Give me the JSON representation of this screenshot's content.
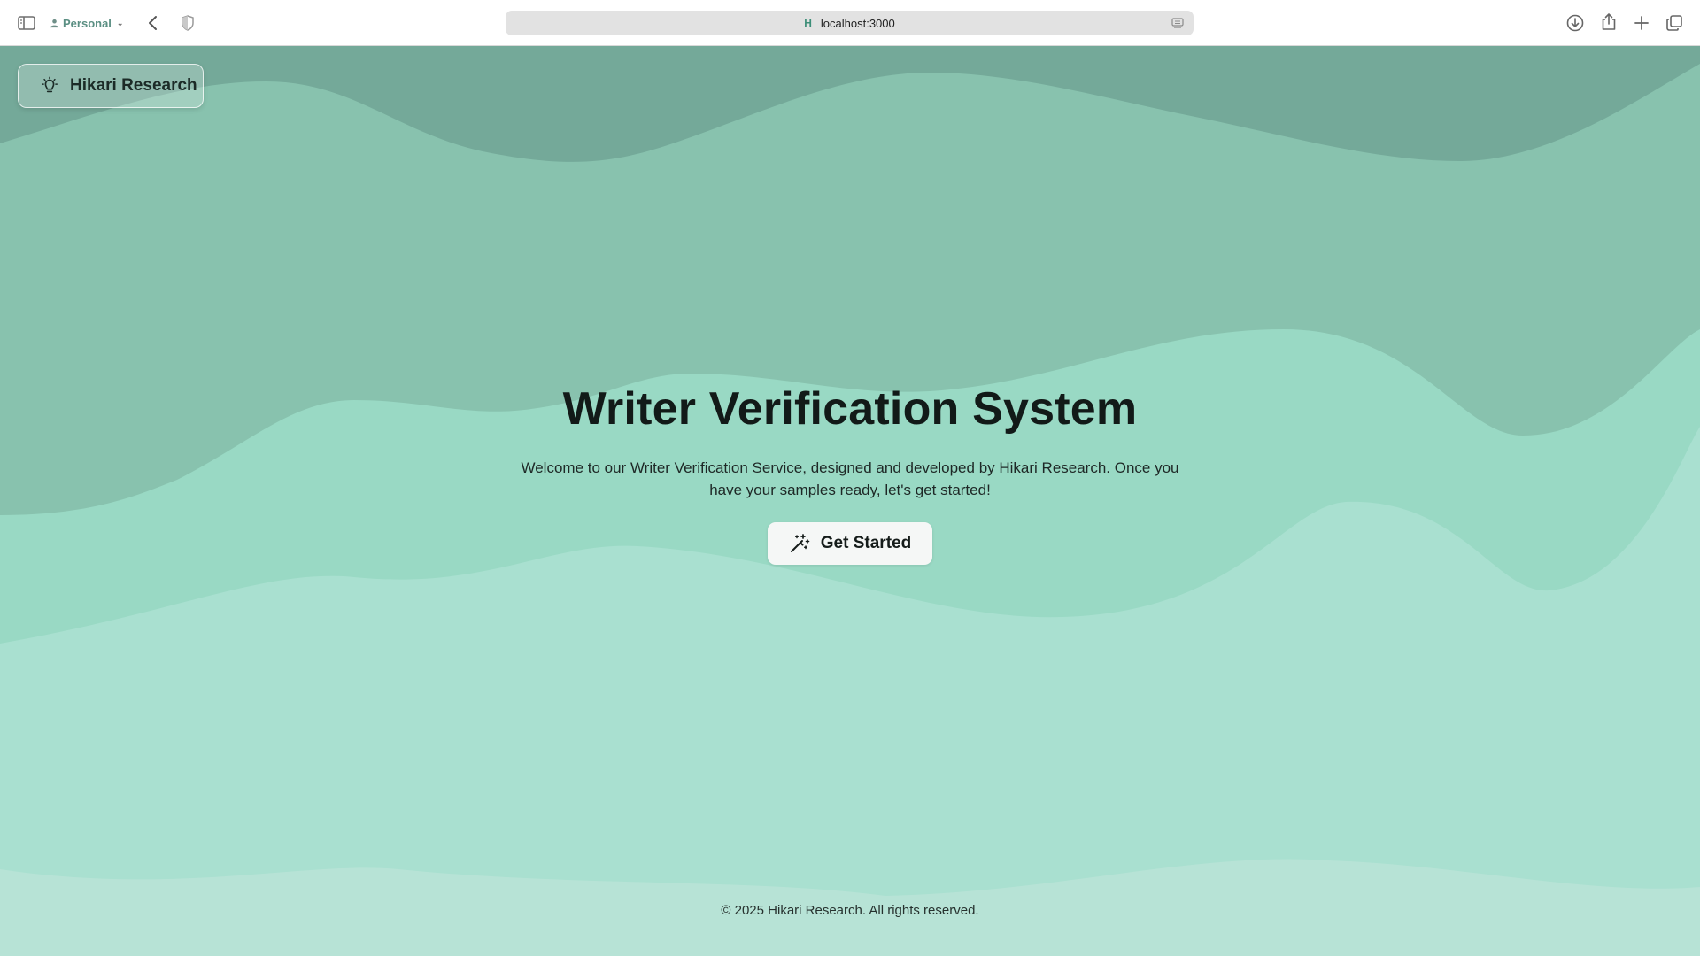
{
  "browser": {
    "profile_label": "Personal",
    "url": "localhost:3000",
    "site_icon_letter": "H",
    "icons": [
      "sidebar-icon",
      "person-icon",
      "chevron-down-icon",
      "back-icon",
      "shield-icon",
      "reader-icon",
      "download-icon",
      "share-icon",
      "plus-icon",
      "tabs-icon"
    ]
  },
  "brand": {
    "name": "Hikari Research",
    "icon": "lightbulb-icon"
  },
  "hero": {
    "title": "Writer Verification System",
    "description": "Welcome to our Writer Verification Service, designed and developed by Hikari Research. Once you have your samples ready, let's get started!",
    "cta_label": "Get Started",
    "cta_icon": "magic-wand-icon"
  },
  "footer": {
    "copyright": "© 2025 Hikari Research. All rights reserved."
  },
  "colors": {
    "wave_dark": "#74a999",
    "wave_mid": "#88c2ae",
    "wave_light": "#99d9c4",
    "wave_lighter": "#a9e0d0",
    "wave_lightest": "#b7e3d6"
  }
}
